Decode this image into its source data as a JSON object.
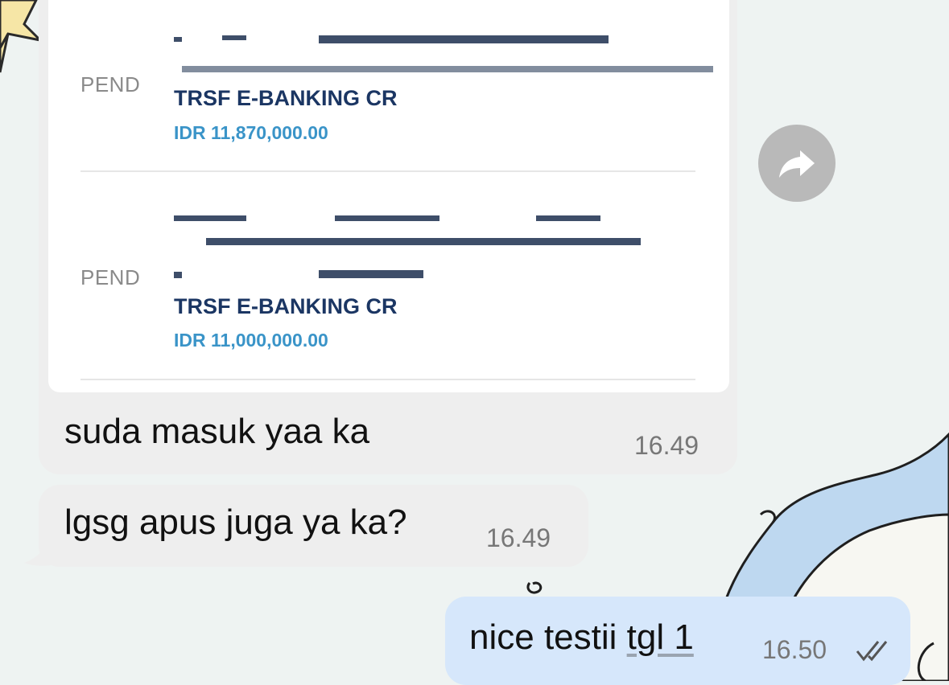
{
  "colors": {
    "incoming_bubble": "#eeeeee",
    "outgoing_bubble": "#d6e7fb",
    "txn_title": "#1b3663",
    "txn_amount": "#3a94c8",
    "forward_button": "#b9b9b9"
  },
  "forwarded_screenshot": {
    "transactions": [
      {
        "status": "PEND",
        "title": "TRSF E-BANKING CR",
        "amount": "IDR 11,870,000.00",
        "redacted": true
      },
      {
        "status": "PEND",
        "title": "TRSF E-BANKING CR",
        "amount": "IDR 11,000,000.00",
        "redacted": true
      }
    ]
  },
  "messages": [
    {
      "direction": "incoming",
      "text": "suda masuk yaa ka",
      "time": "16.49"
    },
    {
      "direction": "incoming",
      "text": "lgsg apus juga ya ka?",
      "time": "16.49"
    },
    {
      "direction": "outgoing",
      "text_main": "nice testii ",
      "text_underlined": "tgl 1",
      "time": "16.50",
      "status_icon": "double-check-icon"
    }
  ],
  "forward_button": {
    "icon": "forward-arrow-icon"
  }
}
